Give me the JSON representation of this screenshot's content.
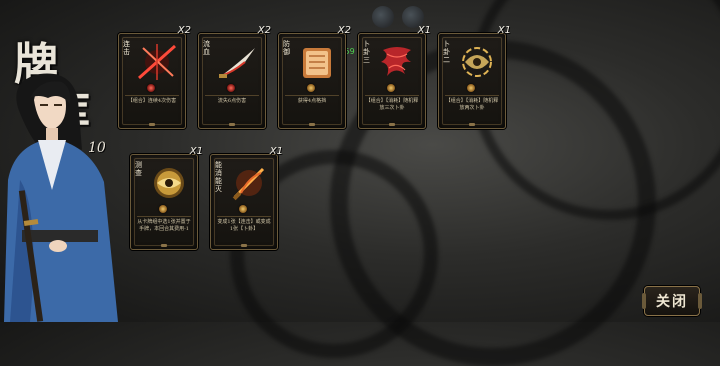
{
  "title": {
    "chars": [
      "牌",
      "库"
    ],
    "count": "10"
  },
  "fps": "FPS59",
  "cards": [
    {
      "name": "连击",
      "count": "X2",
      "text": "【组合】连续4次伤害",
      "art": "red-slash-icon",
      "gem": "red"
    },
    {
      "name": "流血",
      "count": "X2",
      "text": "流失6点伤害",
      "art": "blade-icon",
      "gem": "red"
    },
    {
      "name": "防御",
      "count": "X2",
      "text": "获得4点格挡",
      "art": "shield-icon",
      "gem": "gold"
    },
    {
      "name": "卜卦三",
      "count": "X1",
      "text": "【组合】【消耗】随机释放三次卜卦",
      "art": "crimson-flower-icon",
      "gem": "gold"
    },
    {
      "name": "卜卦二",
      "count": "X1",
      "text": "【组合】【消耗】随机释放两次卜卦",
      "art": "golden-wind-icon",
      "gem": "gold"
    },
    {
      "name": "测查",
      "count": "X1",
      "text": "从卡牌组中选1张并置于手牌，本回合其费用-1",
      "art": "golden-eye-icon",
      "gem": "gold"
    },
    {
      "name": "能消能灭",
      "count": "X1",
      "text": "变成1张【连击】或变成1张【卜卦】",
      "art": "fire-sword-icon",
      "gem": "gold"
    }
  ],
  "close_button": {
    "label": "关闭"
  },
  "colors": {
    "frame": "#6b5a3a",
    "accent_red": "#d6382a",
    "gold": "#e0b455",
    "fps_green": "#4fd24f"
  }
}
